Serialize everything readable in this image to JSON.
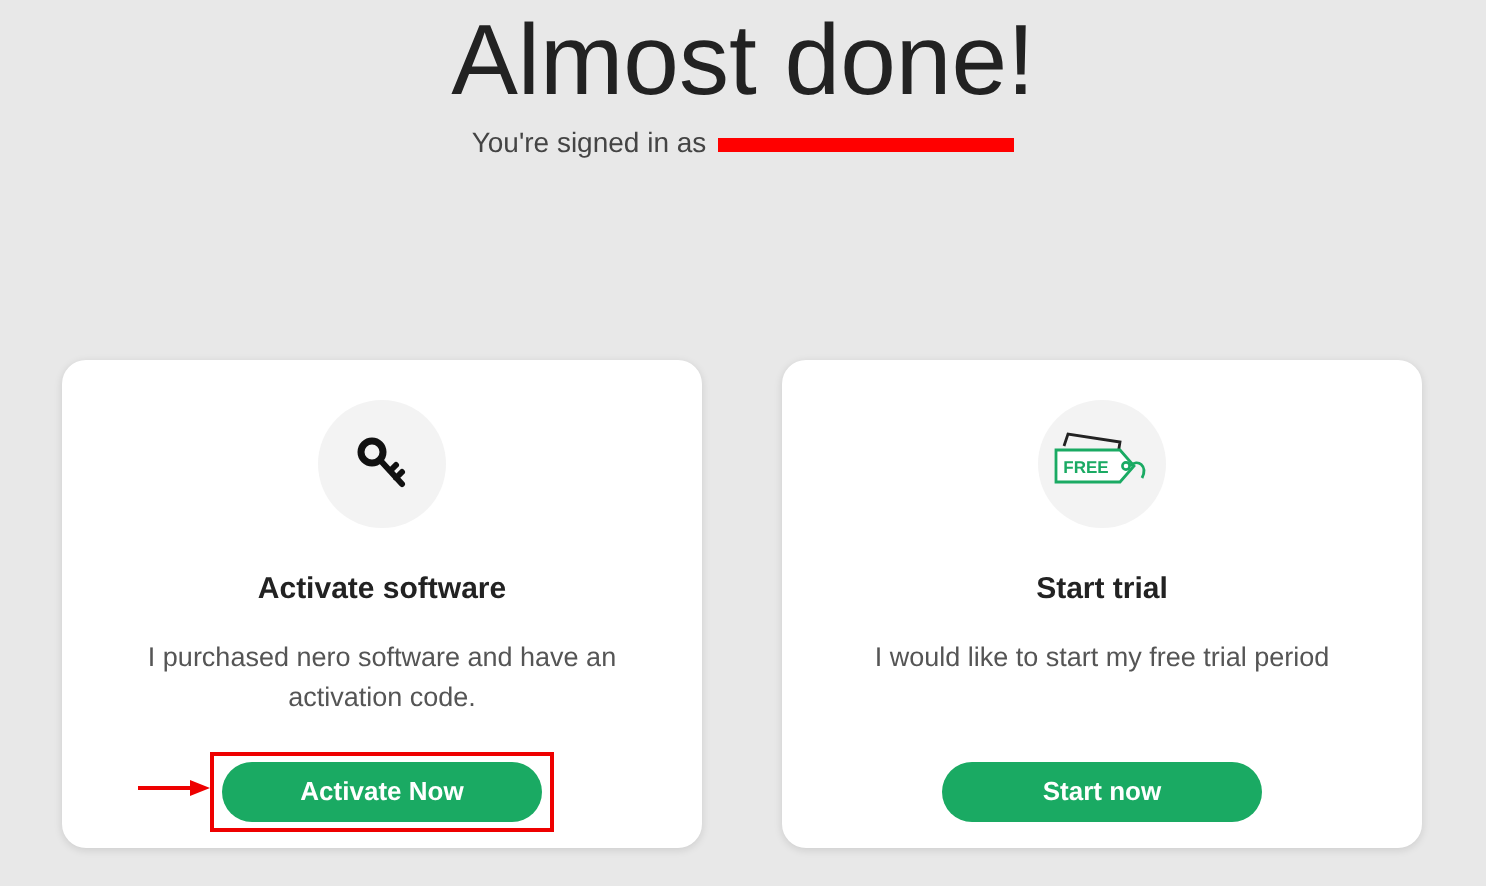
{
  "heading": "Almost done!",
  "signed_in": {
    "label": "You're signed in as",
    "redacted": true
  },
  "cards": [
    {
      "kind": "key",
      "title": "Activate software",
      "description": "I purchased nero software and have an activation code.",
      "button": "Activate Now",
      "highlighted": true
    },
    {
      "kind": "tag",
      "icon_text": "FREE",
      "title": "Start trial",
      "description": "I would like to start my free trial period",
      "button": "Start now",
      "highlighted": false
    }
  ]
}
